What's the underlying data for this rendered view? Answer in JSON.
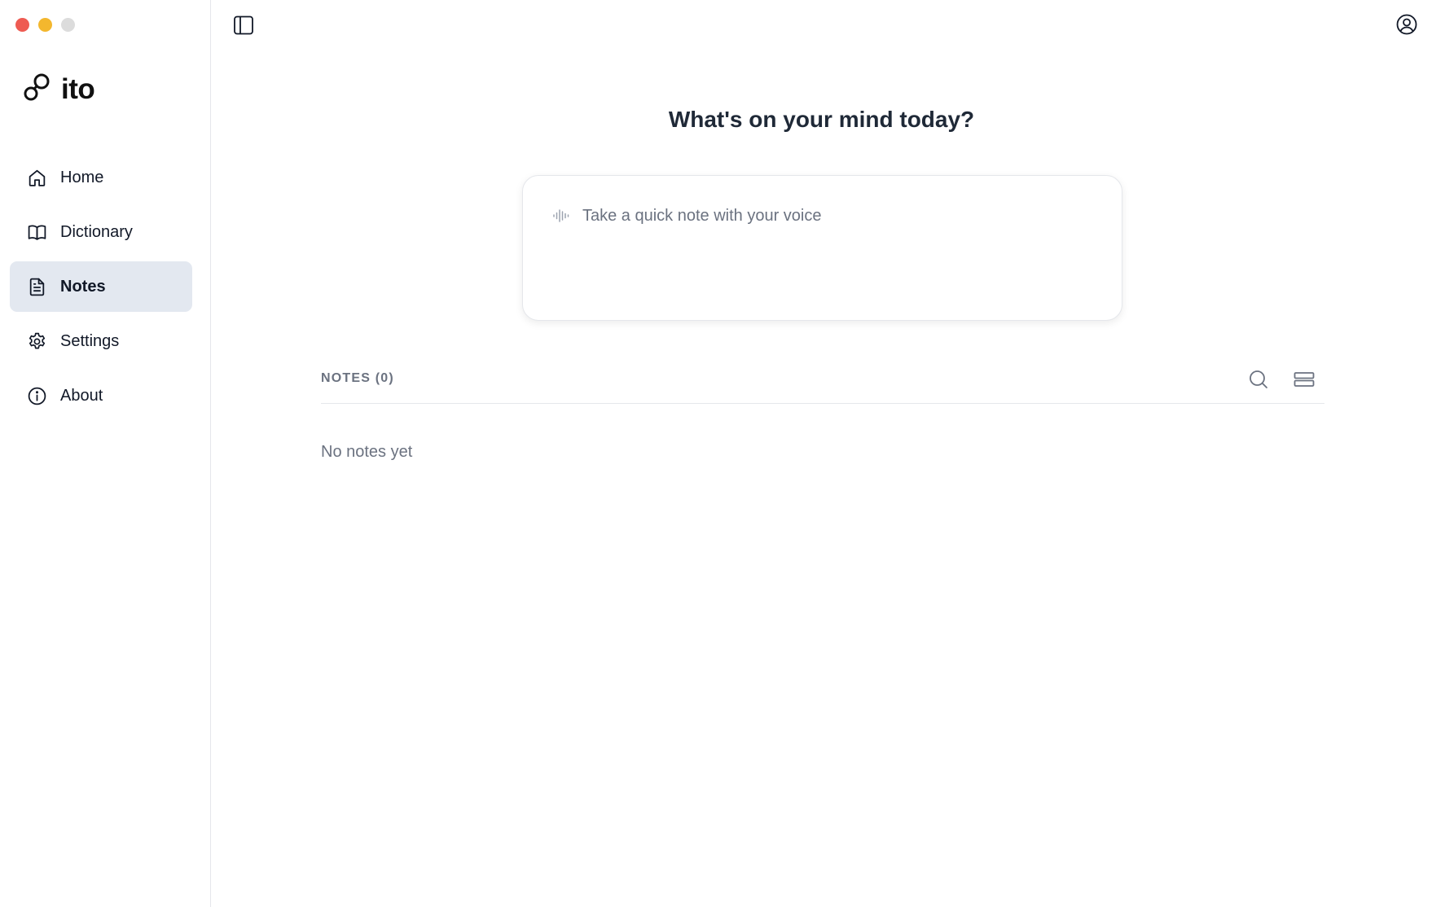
{
  "app": {
    "name": "ito"
  },
  "window_controls": [
    "close",
    "minimize",
    "maximize"
  ],
  "sidebar": {
    "items": [
      {
        "label": "Home",
        "icon": "home-icon",
        "active": false
      },
      {
        "label": "Dictionary",
        "icon": "book-icon",
        "active": false
      },
      {
        "label": "Notes",
        "icon": "file-text-icon",
        "active": true
      },
      {
        "label": "Settings",
        "icon": "gear-icon",
        "active": false
      },
      {
        "label": "About",
        "icon": "info-icon",
        "active": false
      }
    ]
  },
  "topbar": {
    "left_icon": "sidebar-toggle-icon",
    "right_icon": "account-icon"
  },
  "main": {
    "headline": "What's on your mind today?",
    "note_input": {
      "placeholder": "Take a quick note with your voice",
      "value": "",
      "icon": "audio-wave-icon"
    },
    "notes_section": {
      "title": "NOTES (0)",
      "search_icon": "search-icon",
      "layout_icon": "list-layout-icon",
      "empty_text": "No notes yet"
    }
  },
  "colors": {
    "active_nav_bg": "#e3e8f0",
    "close": "#ee5b52",
    "minimize": "#f3b72e",
    "maximize": "#dcdcdc",
    "muted_text": "#6b7280"
  }
}
